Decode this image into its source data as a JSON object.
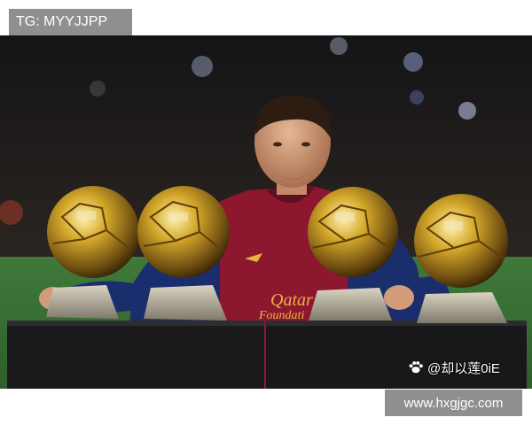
{
  "watermark_top": "TG: MYYJJPP",
  "weibo_handle": "@却以莲0iE",
  "watermark_bottom": "www.hxgjgc.com",
  "shirt_text_1": "Qatar",
  "shirt_text_2": "Foundati",
  "icons": {
    "weibo": "paw-icon"
  },
  "colors": {
    "watermark_bg": "#8f8f8f",
    "shirt_blue": "#1a2e6e",
    "shirt_red": "#8e1730",
    "gold": "#d4a82a",
    "pitch": "#3f7a3a"
  }
}
